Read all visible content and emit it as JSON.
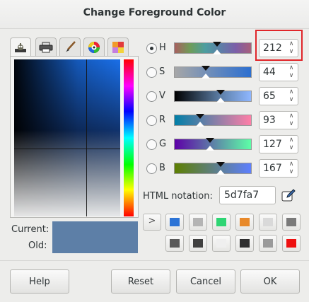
{
  "window": {
    "title": "Change Foreground Color"
  },
  "tabs": [
    {
      "icon": "gimp-wilber-icon",
      "active": true
    },
    {
      "icon": "printer-cmyk-icon",
      "active": false
    },
    {
      "icon": "watercolor-brush-icon",
      "active": false
    },
    {
      "icon": "color-wheel-icon",
      "active": false
    },
    {
      "icon": "palette-icon",
      "active": false
    }
  ],
  "swatches": {
    "current_label": "Current:",
    "old_label": "Old:",
    "current_color": "#5d7fa7",
    "old_color": "#5d7fa7"
  },
  "channels": [
    {
      "label": "H",
      "value": "212",
      "selected": true
    },
    {
      "label": "S",
      "value": "44",
      "selected": false
    },
    {
      "label": "V",
      "value": "65",
      "selected": false
    },
    {
      "label": "R",
      "value": "93",
      "selected": false
    },
    {
      "label": "G",
      "value": "127",
      "selected": false
    },
    {
      "label": "B",
      "value": "167",
      "selected": false
    }
  ],
  "html": {
    "label": "HTML notation:",
    "value": "5d7fa7"
  },
  "expander": {
    "symbol": ">"
  },
  "history_colors": [
    "#2d74d6",
    "#b4b4b4",
    "#2ed573",
    "#e8892a",
    "#d9d9d9",
    "#7a7a7a",
    "#5a5a5a",
    "#404040",
    "#efefef",
    "#2f2f2f",
    "#9a9a9a",
    "#ee1010"
  ],
  "buttons": {
    "help": "Help",
    "reset": "Reset",
    "cancel": "Cancel",
    "ok": "OK"
  },
  "colors": {
    "highlight": "#e0262a"
  }
}
